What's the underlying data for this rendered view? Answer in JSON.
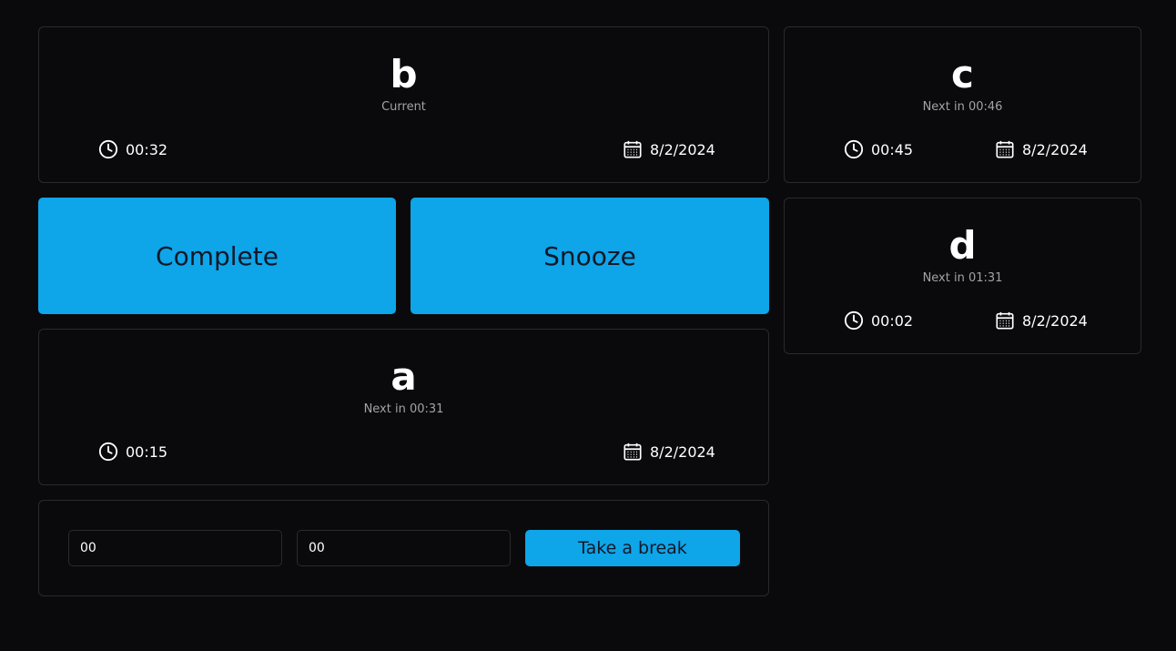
{
  "current": {
    "title": "b",
    "subtitle": "Current",
    "duration": "00:32",
    "date": "8/2/2024"
  },
  "actions": {
    "complete_label": "Complete",
    "snooze_label": "Snooze"
  },
  "queue_a": {
    "title": "a",
    "subtitle": "Next in 00:31",
    "duration": "00:15",
    "date": "8/2/2024"
  },
  "queue_c": {
    "title": "c",
    "subtitle": "Next in 00:46",
    "duration": "00:45",
    "date": "8/2/2024"
  },
  "queue_d": {
    "title": "d",
    "subtitle": "Next in 01:31",
    "duration": "00:02",
    "date": "8/2/2024"
  },
  "break_form": {
    "hours_value": "00",
    "minutes_value": "00",
    "button_label": "Take a break"
  },
  "icons": {
    "duration": "clock-icon",
    "date": "calendar-icon"
  },
  "colors": {
    "background": "#0a0a0c",
    "accent": "#0ea5e9",
    "border": "#2a2a2e",
    "muted_text": "#a1a1aa"
  }
}
